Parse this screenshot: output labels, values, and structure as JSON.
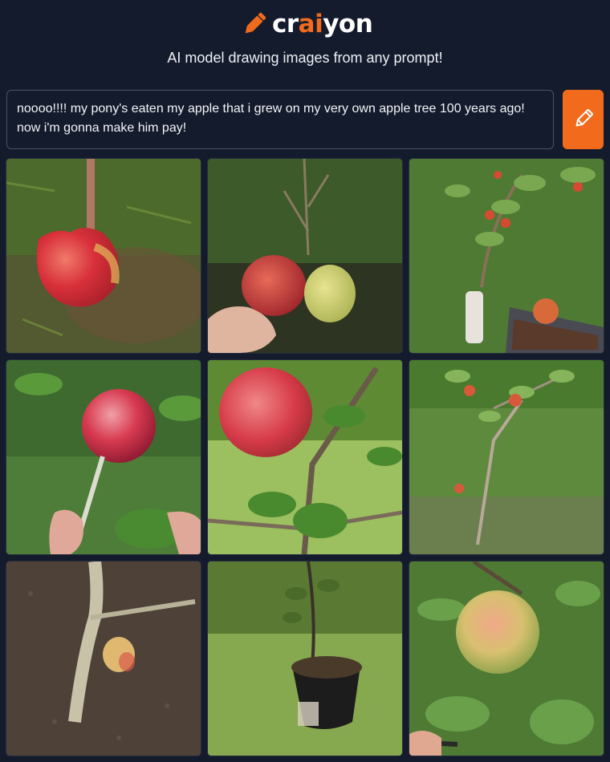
{
  "header": {
    "logo_icon": "pencil-icon",
    "logo_part1": "cr",
    "logo_part2": "ai",
    "logo_part3": "yon",
    "tagline": "AI model drawing images from any prompt!",
    "accent_color": "#f26b1d"
  },
  "prompt": {
    "value": "noooo!!!! my pony's eaten my apple that i grew on my very own apple tree 100 years ago! now i'm gonna make him pay!"
  },
  "draw_button": {
    "icon": "pencil-icon"
  },
  "images": [
    {
      "subject": "red apple on grass"
    },
    {
      "subject": "hand holding two apples"
    },
    {
      "subject": "apple sapling with fallen apple"
    },
    {
      "subject": "apple on branch with hand"
    },
    {
      "subject": "red apple hanging on branch"
    },
    {
      "subject": "young apple tree in grass"
    },
    {
      "subject": "small apple on young trunk"
    },
    {
      "subject": "apple sapling in pot"
    },
    {
      "subject": "apple among leaves"
    }
  ]
}
